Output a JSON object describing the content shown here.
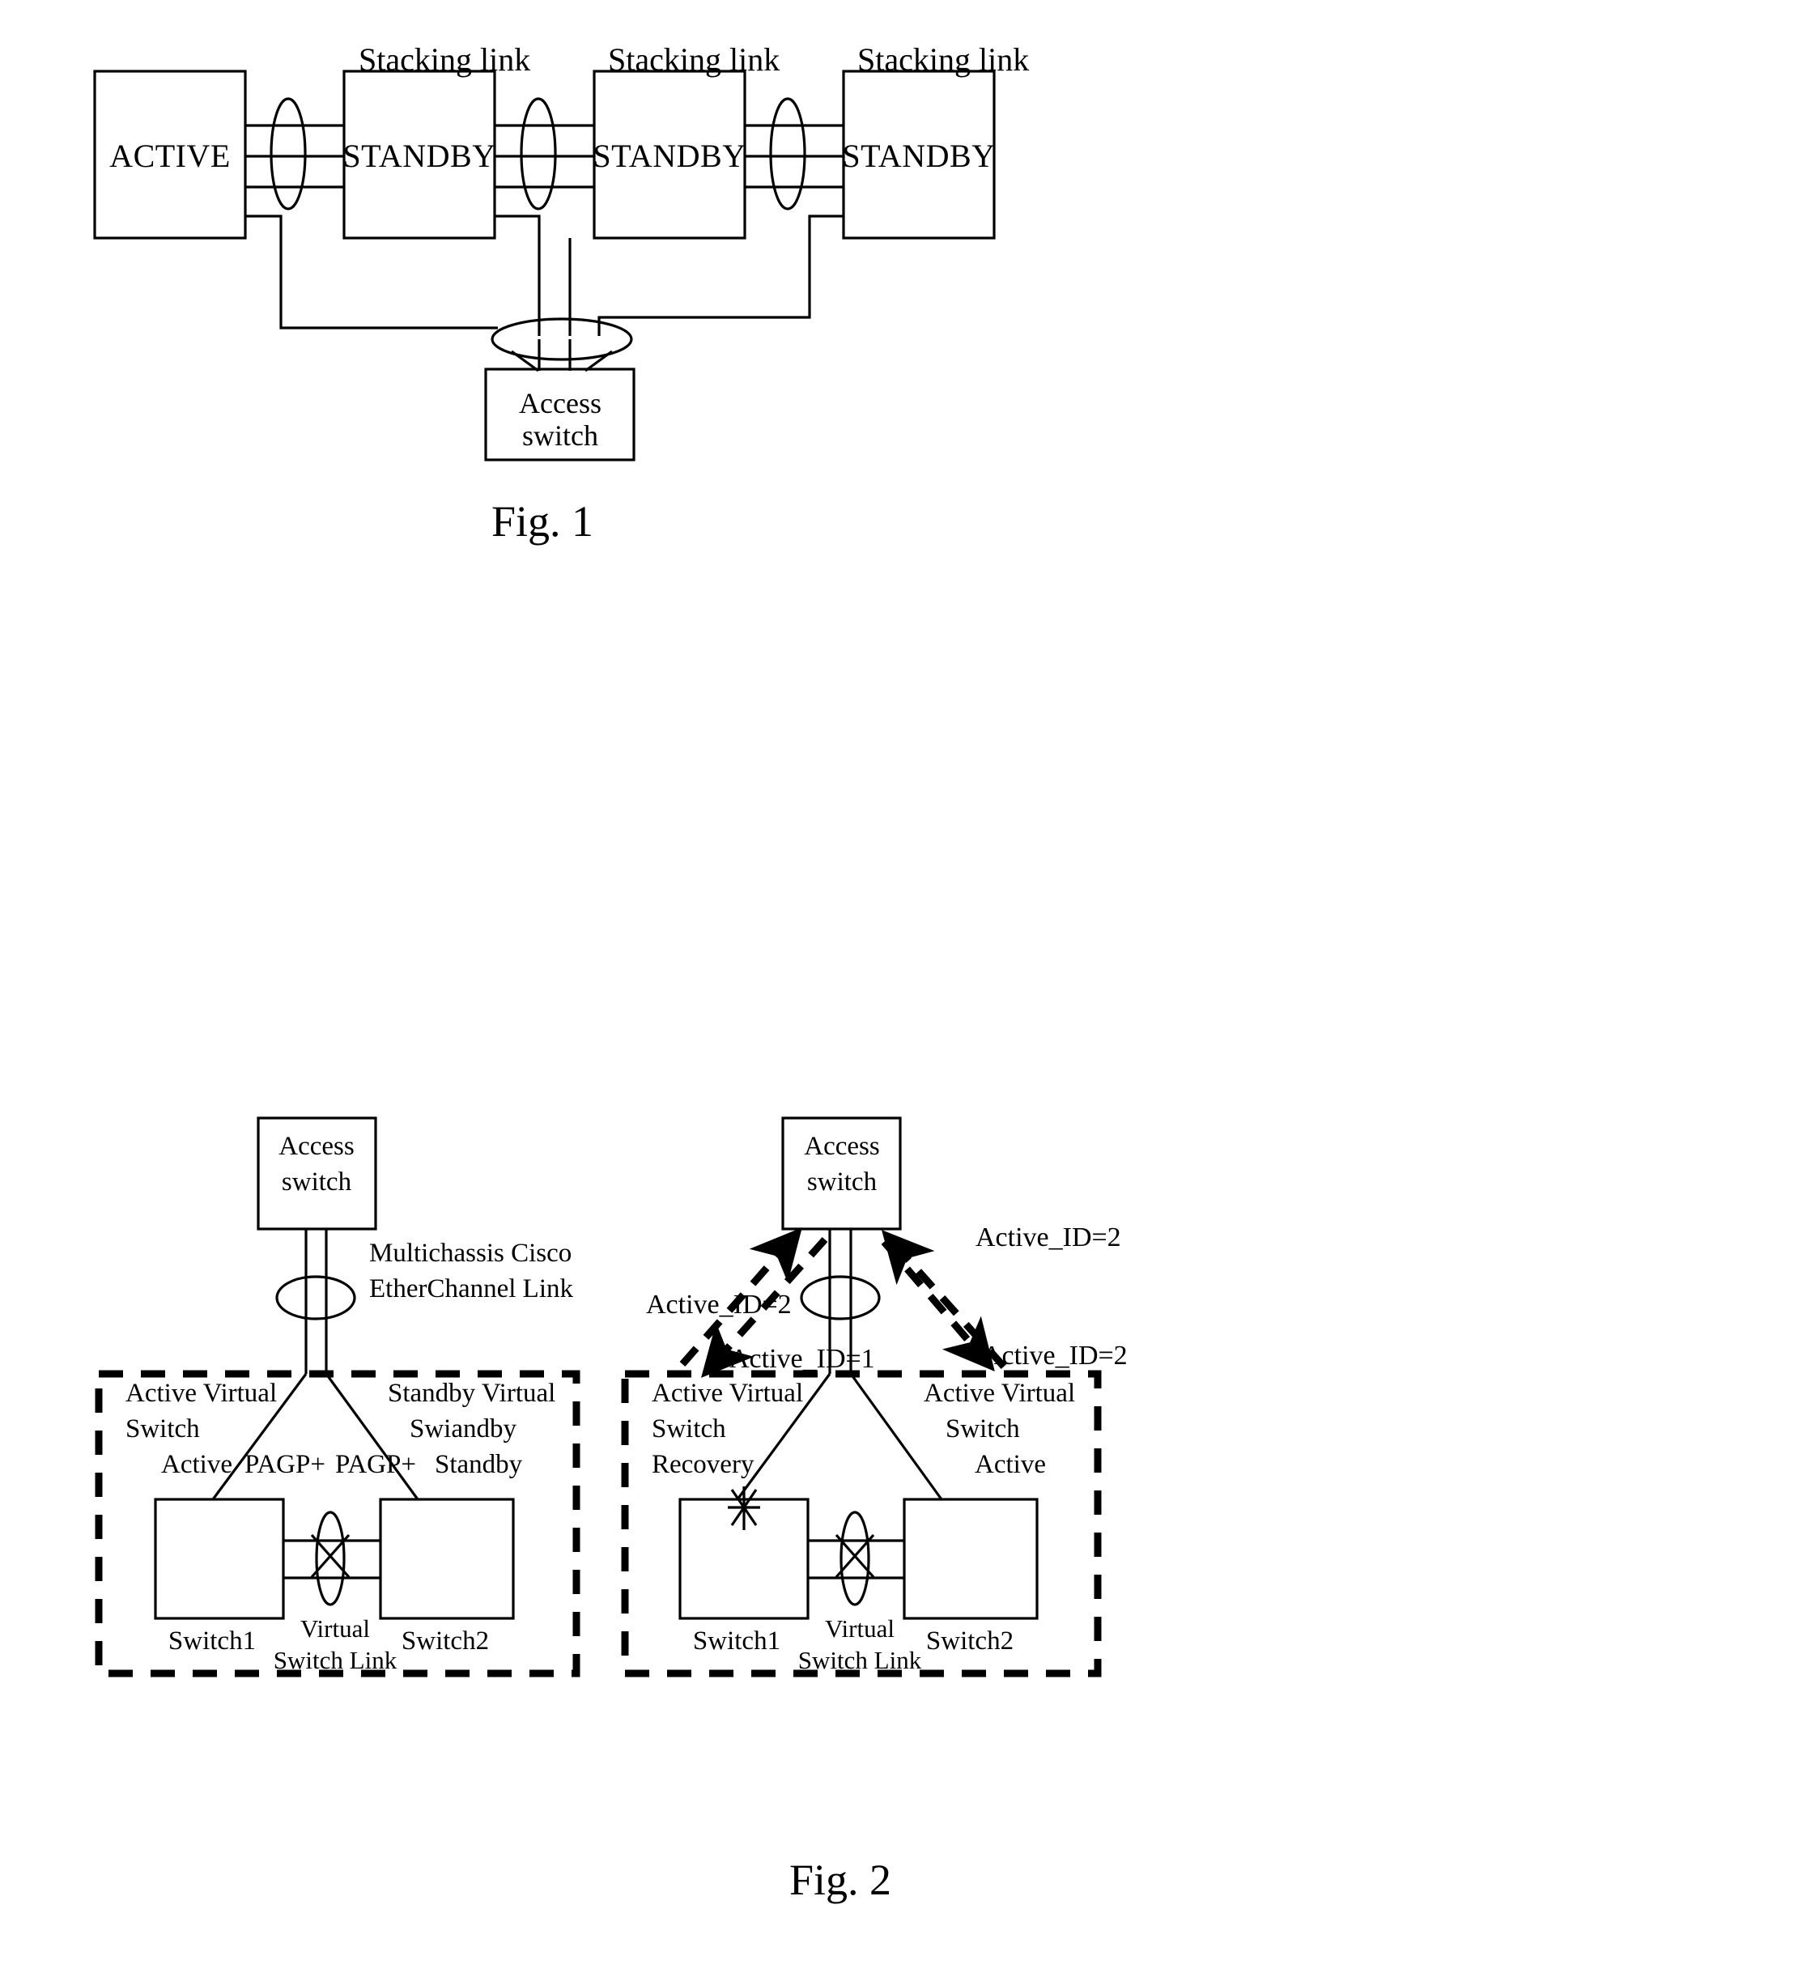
{
  "figure1": {
    "caption": "Fig. 1",
    "nodes": [
      {
        "label": "ACTIVE"
      },
      {
        "label": "STANDBY"
      },
      {
        "label": "STANDBY"
      },
      {
        "label": "STANDBY"
      }
    ],
    "link_labels": [
      "Stacking link",
      "Stacking link",
      "Stacking link"
    ],
    "access_switch": {
      "line1": "Access",
      "line2": "switch"
    }
  },
  "figure2": {
    "caption": "Fig. 2",
    "left_panel": {
      "access_switch": {
        "line1": "Access",
        "line2": "switch"
      },
      "etherchannel_label": {
        "line1": "Multichassis Cisco",
        "line2": "EtherChannel Link"
      },
      "left_role": {
        "line1": "Active Virtual",
        "line2": "Switch",
        "line3": "Active"
      },
      "right_role": {
        "line1": "Standby Virtual",
        "line2": "Swiandby",
        "line3": "Standby"
      },
      "protocol_left": "PAGP+",
      "protocol_right": "PAGP+",
      "switch1": "Switch1",
      "switch2": "Switch2",
      "vsl_label": {
        "line1": "Virtual",
        "line2": "Switch Link"
      }
    },
    "right_panel": {
      "access_switch": {
        "line1": "Access",
        "line2": "switch"
      },
      "left_role": {
        "line1": "Active Virtual",
        "line2": "Switch",
        "line3": "Recovery"
      },
      "right_role": {
        "line1": "Active Virtual",
        "line2": "Switch",
        "line3": "Active"
      },
      "switch1": "Switch1",
      "switch2": "Switch2",
      "vsl_label": {
        "line1": "Virtual",
        "line2": "Switch Link"
      },
      "annotations": [
        {
          "text": "Active_ID=2"
        },
        {
          "text": "Active_ID=2"
        },
        {
          "text": "Active_ID=1"
        },
        {
          "text": "Active_ID=2"
        }
      ]
    }
  },
  "colors": {
    "ink": "#000000",
    "paper": "#ffffff"
  }
}
